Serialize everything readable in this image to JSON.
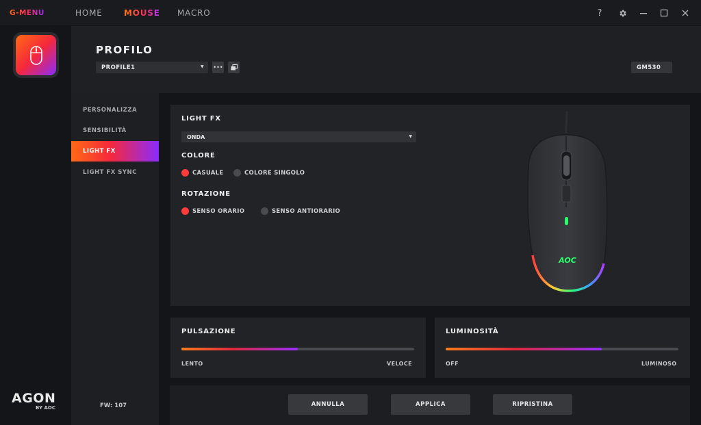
{
  "titlebar": {
    "app_name": "G-MENU",
    "nav": [
      "HOME",
      "MOUSE",
      "MACRO"
    ],
    "active_nav": "MOUSE",
    "help": "?",
    "settings_icon": "gear-icon",
    "minimize_icon": "minimize-icon",
    "maximize_icon": "maximize-icon",
    "close_icon": "close-icon"
  },
  "brand": {
    "agon": "AGON",
    "by_aoc": "BY AOC"
  },
  "header": {
    "title": "PROFILO",
    "profile_selected": "PROFILE1",
    "more_label": "•••",
    "model": "GM530"
  },
  "sidebar": {
    "items": [
      {
        "label": "PERSONALIZZA",
        "active": false
      },
      {
        "label": "SENSIBILITÀ",
        "active": false
      },
      {
        "label": "LIGHT FX",
        "active": true
      },
      {
        "label": "LIGHT FX SYNC",
        "active": false
      }
    ],
    "firmware": "FW: 107"
  },
  "lightfx": {
    "title": "LIGHT FX",
    "effect_selected": "ONDA",
    "color": {
      "title": "COLORE",
      "options": [
        {
          "label": "CASUALE",
          "selected": true
        },
        {
          "label": "COLORE SINGOLO",
          "selected": false
        }
      ]
    },
    "rotation": {
      "title": "ROTAZIONE",
      "options": [
        {
          "label": "SENSO ORARIO",
          "selected": true
        },
        {
          "label": "SENSO ANTIORARIO",
          "selected": false
        }
      ]
    },
    "mouse_logo": "AOC"
  },
  "pulse": {
    "title": "PULSAZIONE",
    "min_label": "LENTO",
    "max_label": "VELOCE",
    "value_percent": 50
  },
  "brightness": {
    "title": "LUMINOSITÀ",
    "min_label": "OFF",
    "max_label": "LUMINOSO",
    "value_percent": 67
  },
  "footer": {
    "cancel": "ANNULLA",
    "apply": "APPLICA",
    "reset": "RIPRISTINA"
  },
  "colors": {
    "accent_orange": "#ff6a14",
    "accent_red": "#f5283c",
    "accent_purple": "#8a2cff",
    "radio_on": "#ff3a3a"
  }
}
